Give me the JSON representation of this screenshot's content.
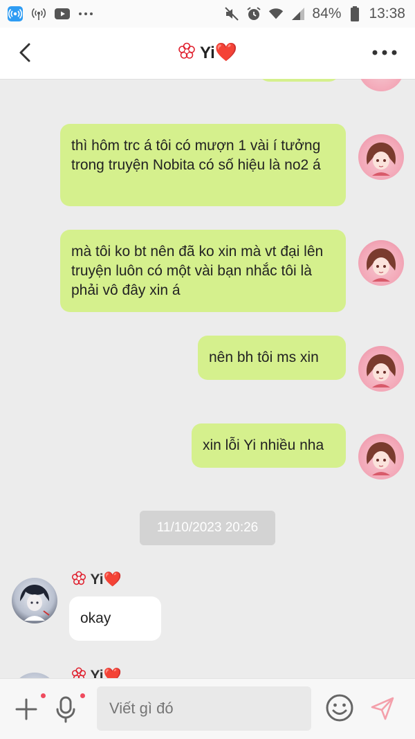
{
  "status_bar": {
    "battery": "84%",
    "time": "13:38",
    "icons": [
      "hotspot-icon",
      "wifi-call-icon",
      "youtube-icon",
      "more-dots-icon",
      "mute-icon",
      "alarm-icon",
      "wifi-icon",
      "signal-icon",
      "battery-icon"
    ]
  },
  "header": {
    "title": "Yi",
    "title_suffix": "❤️",
    "back_icon": "chevron-left-icon",
    "more_icon": "more-horizontal-icon"
  },
  "messages": [
    {
      "side": "out",
      "text": "thì hôm trc á tôi có mượn 1 vài í tưởng trong truyện Nobita có số hiệu là no2 á"
    },
    {
      "side": "out",
      "text": "mà tôi ko bt nên đã ko xin mà vt đại lên truyện luôn có một vài bạn nhắc tôi là phải vô đây xin á"
    },
    {
      "side": "out",
      "text": "nên bh tôi ms xin"
    },
    {
      "side": "out",
      "text": "xin lỗi Yi nhiều nha"
    },
    {
      "side": "in",
      "sender": "Yi",
      "text": "okay"
    },
    {
      "side": "in",
      "sender": "Yi",
      "text": ""
    }
  ],
  "timestamp": "11/10/2023 20:26",
  "input": {
    "placeholder": "Viết gì đó"
  },
  "bottom_bar": {
    "icons": [
      "plus-icon",
      "microphone-icon",
      "emoji-icon",
      "send-icon"
    ]
  },
  "colors": {
    "outgoing_bubble": "#d5f08d",
    "incoming_bubble": "#ffffff",
    "background": "#ececec",
    "heart": "#e0202e",
    "notification_dot": "#ef4b5e"
  }
}
